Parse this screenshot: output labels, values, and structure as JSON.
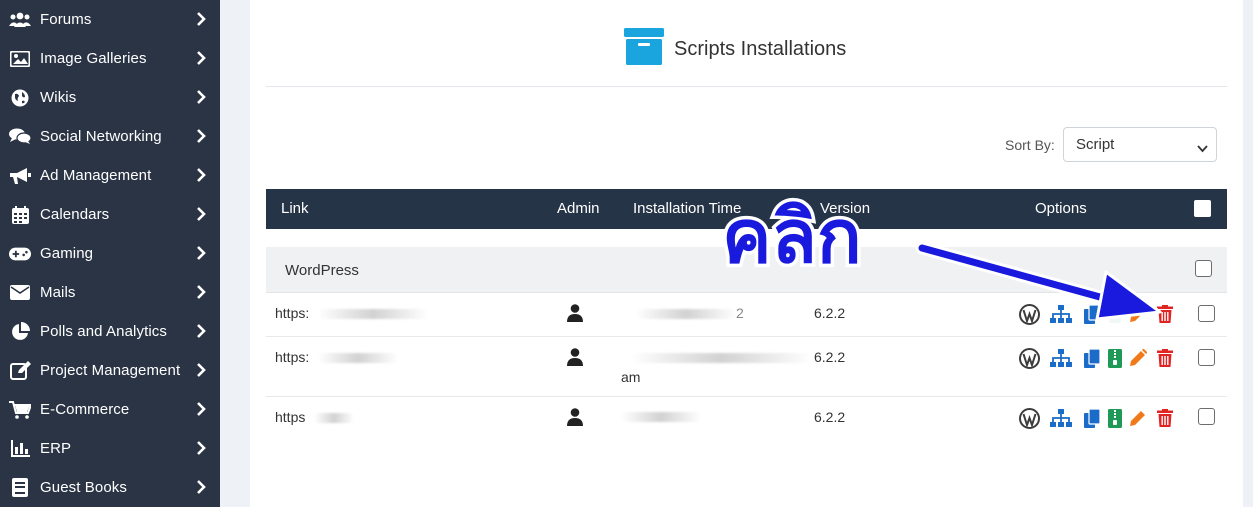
{
  "sidebar": {
    "items": [
      {
        "label": "Forums",
        "icon": "users-icon"
      },
      {
        "label": "Image Galleries",
        "icon": "image-icon"
      },
      {
        "label": "Wikis",
        "icon": "globe-icon"
      },
      {
        "label": "Social Networking",
        "icon": "comments-icon"
      },
      {
        "label": "Ad Management",
        "icon": "megaphone-icon"
      },
      {
        "label": "Calendars",
        "icon": "calendar-icon"
      },
      {
        "label": "Gaming",
        "icon": "gamepad-icon"
      },
      {
        "label": "Mails",
        "icon": "envelope-icon"
      },
      {
        "label": "Polls and Analytics",
        "icon": "pie-chart-icon"
      },
      {
        "label": "Project Management",
        "icon": "edit-icon"
      },
      {
        "label": "E-Commerce",
        "icon": "cart-icon"
      },
      {
        "label": "ERP",
        "icon": "bar-chart-icon"
      },
      {
        "label": "Guest Books",
        "icon": "book-icon"
      }
    ]
  },
  "page": {
    "title": "Scripts Installations",
    "title_icon": "archive-box-icon",
    "sort_label": "Sort By:",
    "sort_value": "Script"
  },
  "table": {
    "headers": {
      "link": "Link",
      "admin": "Admin",
      "time": "Installation Time",
      "version": "Version",
      "options": "Options"
    },
    "group": "WordPress",
    "rows": [
      {
        "link": "https:",
        "time_fragment": "2",
        "time_extra": "",
        "version": "6.2.2"
      },
      {
        "link": "https:",
        "time_fragment": "",
        "time_extra": "am",
        "version": "6.2.2"
      },
      {
        "link": "https",
        "time_fragment": "",
        "time_extra": "",
        "version": "6.2.2"
      }
    ]
  },
  "annotation": {
    "text": "คลิก",
    "color": "#1a1adf"
  },
  "colors": {
    "sidebar_bg": "#2a3444",
    "header_bg": "#253447",
    "accent_blue": "#1b6bc8",
    "edit_orange": "#f07a1a",
    "delete_red": "#e02424",
    "archive_green": "#1e9a56"
  }
}
